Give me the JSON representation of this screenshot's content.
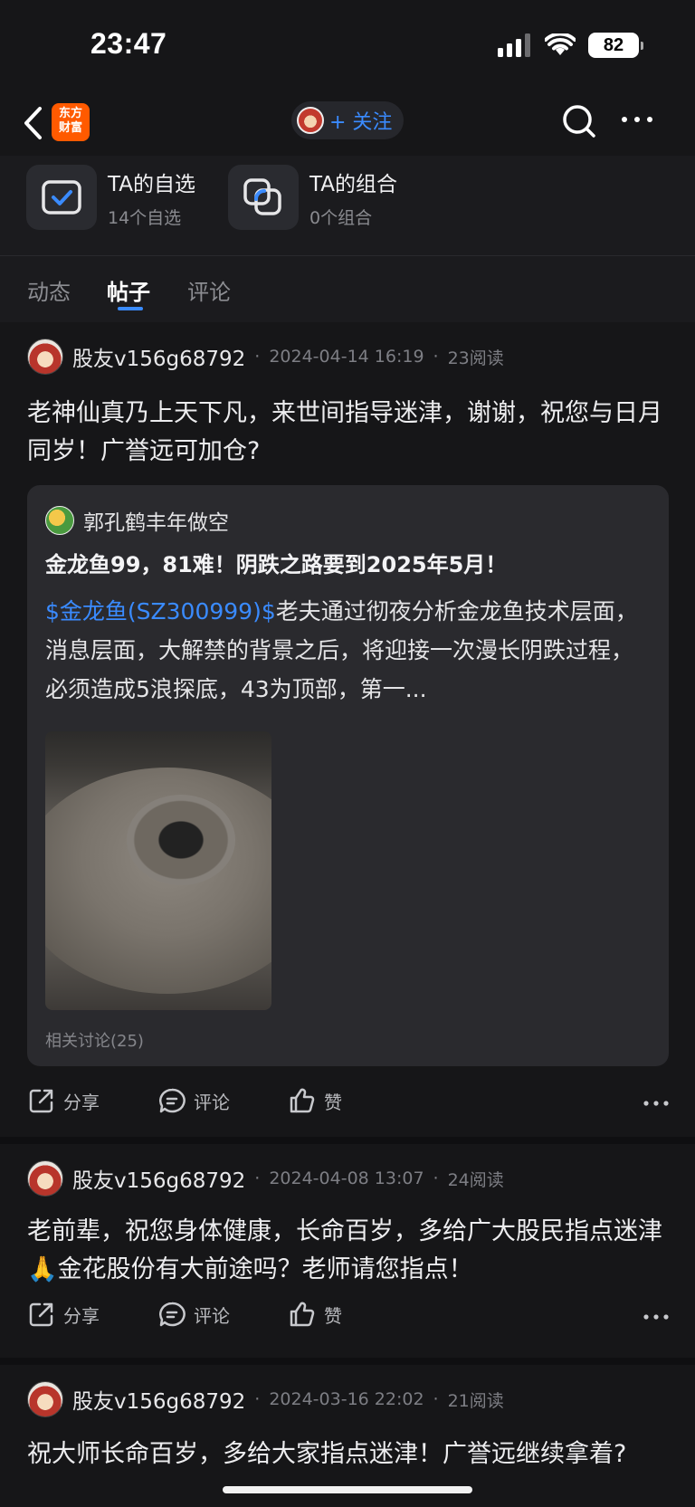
{
  "status_bar": {
    "time": "23:47",
    "battery": "82"
  },
  "nav": {
    "logo_line1": "东方",
    "logo_line2": "财富",
    "follow_label": "+ 关注"
  },
  "quick": [
    {
      "title": "TA的自选",
      "sub": "14个自选"
    },
    {
      "title": "TA的组合",
      "sub": "0个组合"
    }
  ],
  "tabs": [
    "动态",
    "帖子",
    "评论"
  ],
  "posts": [
    {
      "author": "股友v156g68792",
      "date": "2024-04-14 16:19",
      "reads": "23阅读",
      "text": "老神仙真乃上天下凡，来世间指导迷津，谢谢，祝您与日月同岁！广誉远可加仓?",
      "quote": {
        "author": "郭孔鹤丰年做空",
        "title": "金龙鱼99，81难！阴跌之路要到2025年5月！",
        "link": "$金龙鱼(SZ300999)$",
        "body": "老夫通过彻夜分析金龙鱼技术层面，消息层面，大解禁的背景之后，将迎接一次漫长阴跌过程，必须造成5浪探底，43为顶部，第一...",
        "related": "相关讨论(25)"
      }
    },
    {
      "author": "股友v156g68792",
      "date": "2024-04-08 13:07",
      "reads": "24阅读",
      "text": "老前辈，祝您身体健康，长命百岁，多给广大股民指点迷津🙏金花股份有大前途吗？老师请您指点！"
    },
    {
      "author": "股友v156g68792",
      "date": "2024-03-16 22:02",
      "reads": "21阅读",
      "text": "祝大师长命百岁，多给大家指点迷津！广誉远继续拿着?"
    }
  ],
  "actions": {
    "share": "分享",
    "comment": "评论",
    "like": "赞"
  },
  "separator": "·",
  "colors": {
    "accent": "#3a8bff",
    "background": "#161618",
    "logo": "#ff5a00"
  }
}
